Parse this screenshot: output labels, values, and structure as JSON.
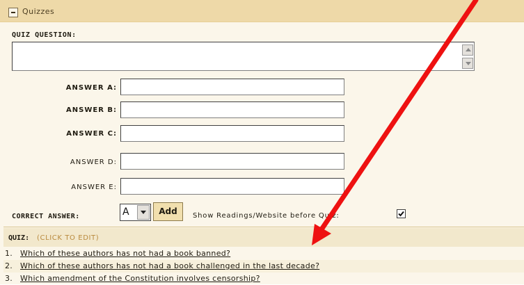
{
  "header": {
    "title": "Quizzes"
  },
  "form": {
    "quiz_question_label": "QUIZ QUESTION:",
    "quiz_question_value": "",
    "answers": [
      {
        "label": "ANSWER A:",
        "value": ""
      },
      {
        "label": "ANSWER B:",
        "value": ""
      },
      {
        "label": "ANSWER C:",
        "value": ""
      },
      {
        "label": "ANSWER D:",
        "value": ""
      },
      {
        "label": "ANSWER E:",
        "value": ""
      }
    ],
    "correct_answer_label": "CORRECT ANSWER:",
    "correct_answer_value": "A",
    "add_button": "Add",
    "show_readings_label": "Show Readings/Website before Quiz:",
    "show_readings_checked": true
  },
  "quiz": {
    "title": "QUIZ:",
    "edit_hint": "(CLICK TO EDIT)",
    "items": [
      {
        "num": "1.",
        "text": "Which of these authors has not had a book banned?"
      },
      {
        "num": "2.",
        "text": "Which of these authors has not had a book challenged in the last decade?"
      },
      {
        "num": "3.",
        "text": "Which amendment of the Constitution involves censorship?"
      }
    ]
  },
  "annotation": {
    "arrow_color": "#ee1111"
  }
}
